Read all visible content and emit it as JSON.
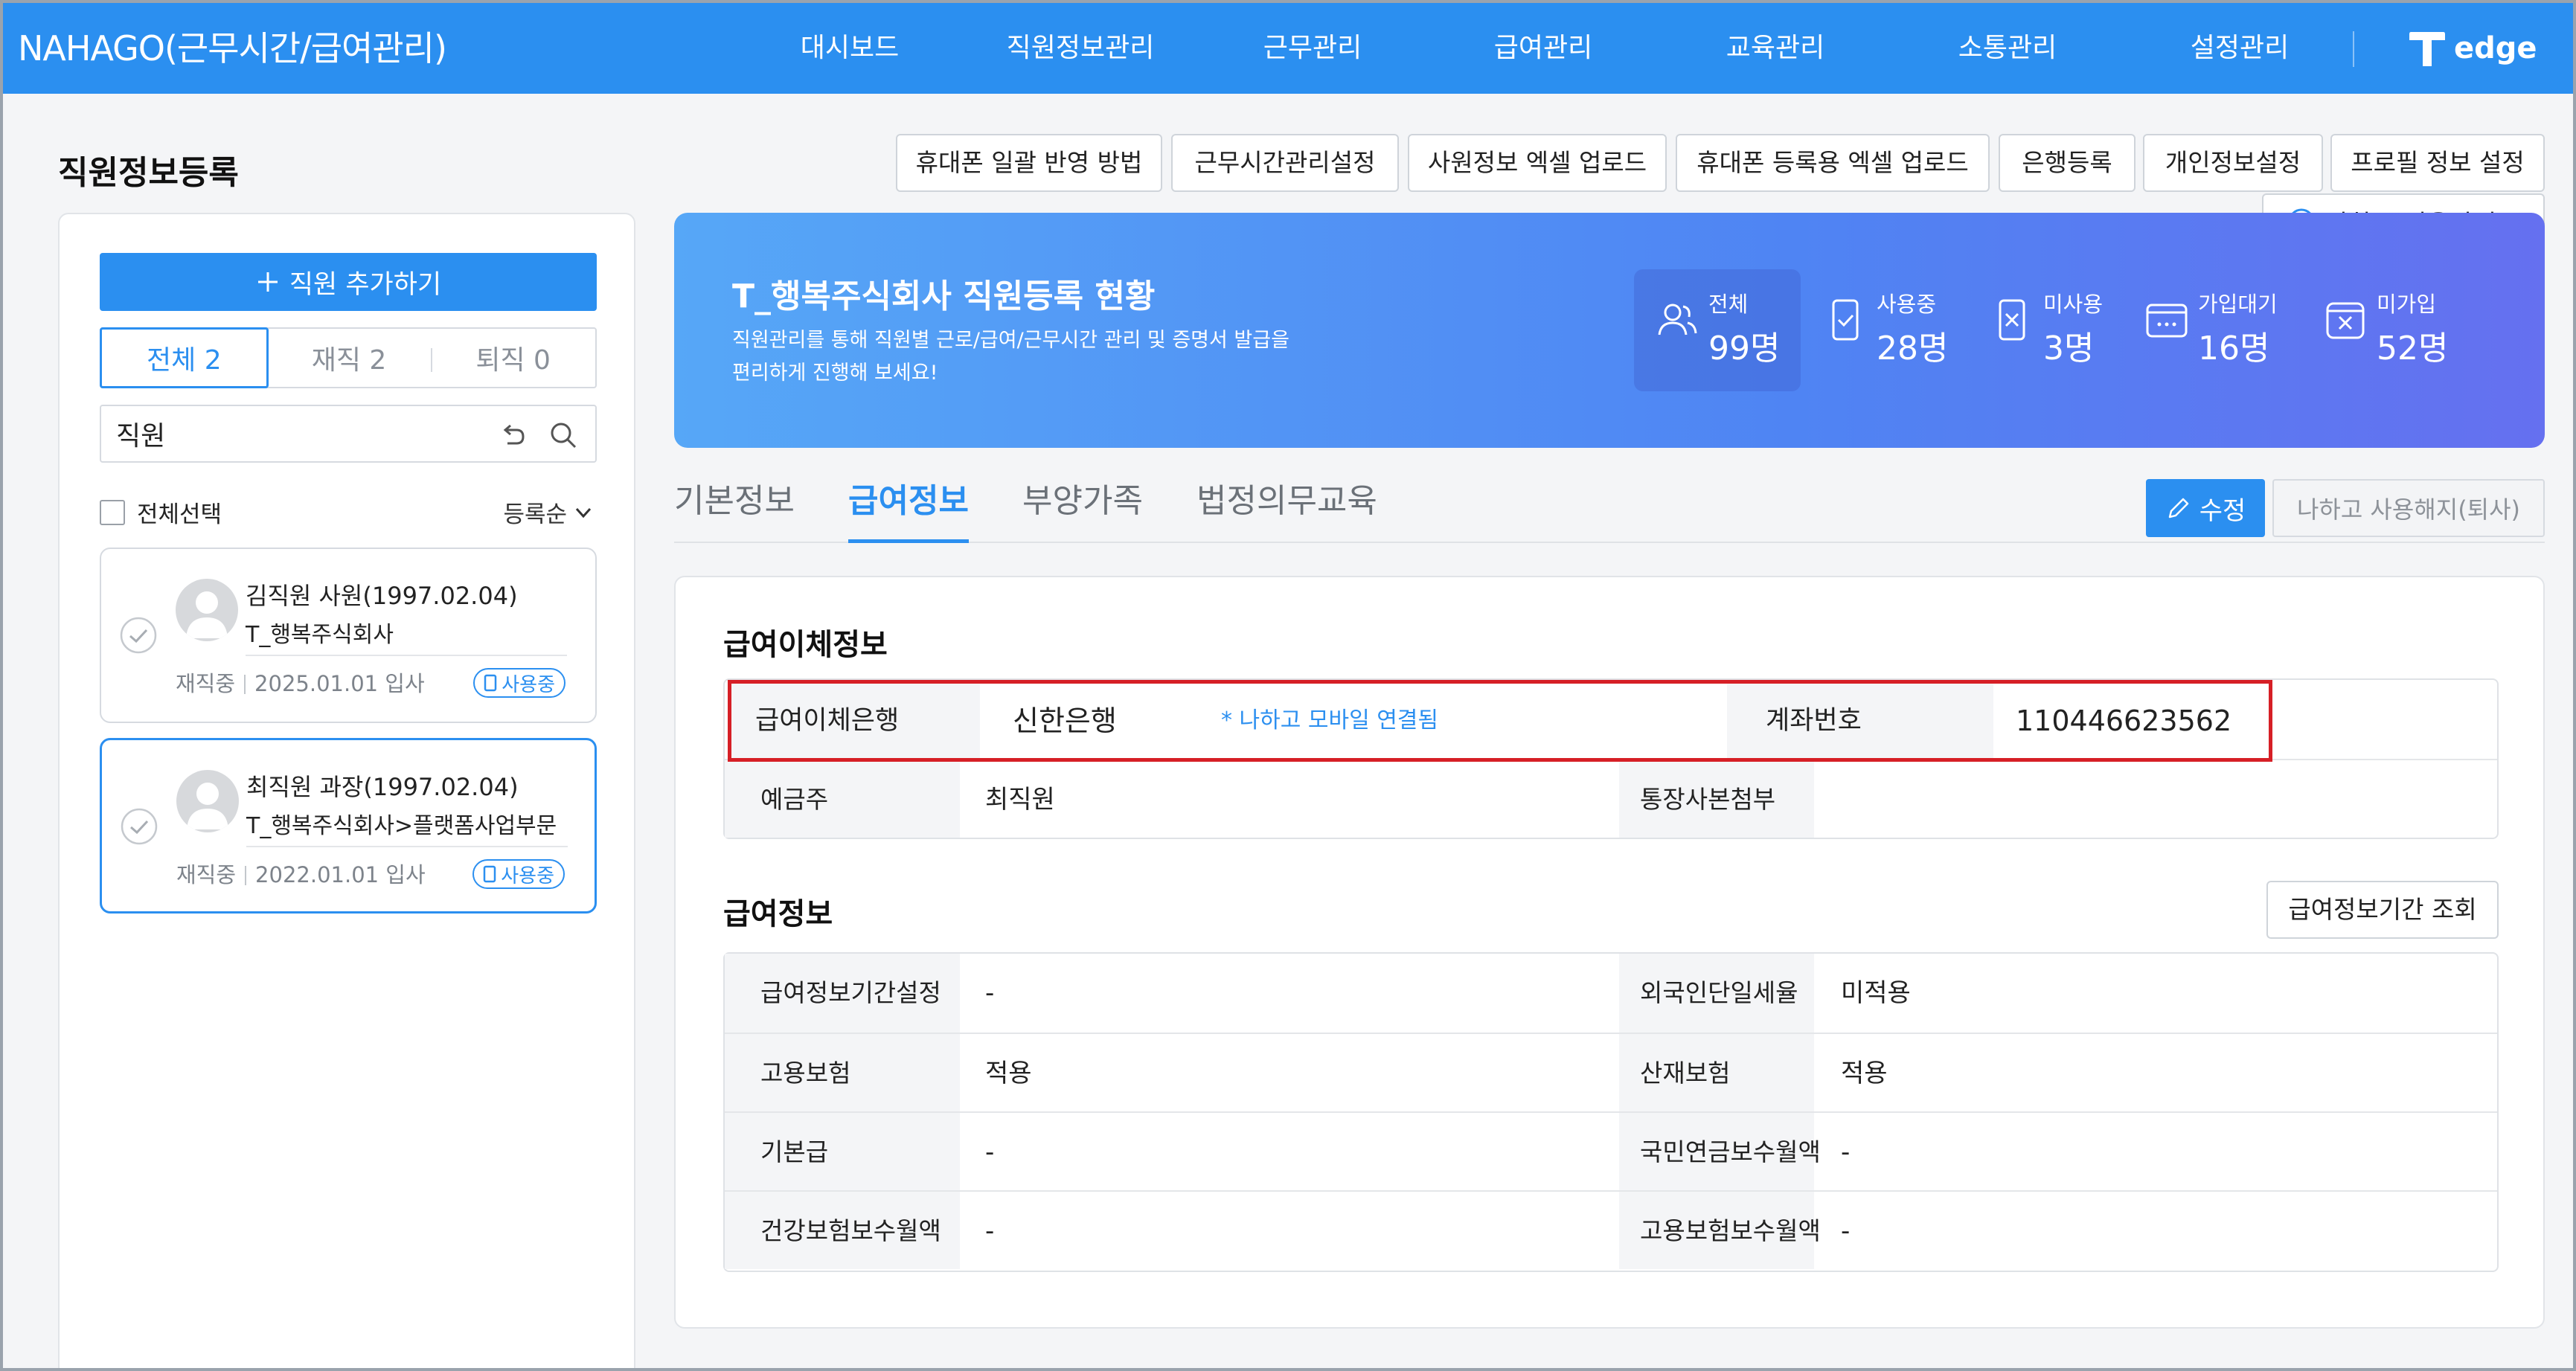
{
  "header": {
    "brand": "NAHAGO(근무시간/급여관리)",
    "nav": [
      "대시보드",
      "직원정보관리",
      "근무관리",
      "급여관리",
      "교육관리",
      "소통관리",
      "설정관리"
    ],
    "logo_text": "edge"
  },
  "page_title": "직원정보등록",
  "toolbar": [
    "휴대폰 일괄 반영 방법",
    "근무시간관리설정",
    "사원정보 엑셀 업로드",
    "휴대폰 등록용 엑셀 업로드",
    "은행등록",
    "개인정보설정",
    "프로필 정보 설정"
  ],
  "guide_label": "나하고 이용가이드",
  "sidebar": {
    "add_button": "직원 추가하기",
    "filters": [
      "전체 2",
      "재직 2",
      "퇴직 0"
    ],
    "active_filter": 0,
    "search_value": "직원",
    "select_all_label": "전체선택",
    "sort_label": "등록순",
    "employees": [
      {
        "name": "김직원 사원(1997.02.04)",
        "org": "T_행복주식회사",
        "status": "재직중",
        "join": "2025.01.01 입사",
        "badge": "사용중",
        "selected": false
      },
      {
        "name": "최직원 과장(1997.02.04)",
        "org": "T_행복주식회사>플랫폼사업부문",
        "status": "재직중",
        "join": "2022.01.01 입사",
        "badge": "사용중",
        "selected": true
      }
    ]
  },
  "banner": {
    "title": "T_행복주식회사 직원등록 현황",
    "desc_line1": "직원관리를 통해 직원별 근로/급여/근무시간 관리 및 증명서 발급을",
    "desc_line2": "편리하게 진행해 보세요!",
    "stats": [
      {
        "label": "전체",
        "value": "99명",
        "icon": "people-icon"
      },
      {
        "label": "사용중",
        "value": "28명",
        "icon": "phone-check-icon"
      },
      {
        "label": "미사용",
        "value": "3명",
        "icon": "phone-x-icon"
      },
      {
        "label": "가입대기",
        "value": "16명",
        "icon": "pending-icon"
      },
      {
        "label": "미가입",
        "value": "52명",
        "icon": "unregistered-icon"
      }
    ]
  },
  "tabs": [
    "기본정보",
    "급여정보",
    "부양가족",
    "법정의무교육"
  ],
  "active_tab": 1,
  "edit_button": "수정",
  "resign_button": "나하고 사용해지(퇴사)",
  "payroll_transfer": {
    "title": "급여이체정보",
    "bank_label": "급여이체은행",
    "bank_value": "신한은행",
    "mobile_note": "* 나하고 모바일 연결됨",
    "account_label": "계좌번호",
    "account_value": "110446623562",
    "holder_label": "예금주",
    "holder_value": "최직원",
    "bankbook_label": "통장사본첨부",
    "bankbook_value": ""
  },
  "salary_info": {
    "title": "급여정보",
    "period_button": "급여정보기간 조회",
    "rows": [
      {
        "l1": "급여정보기간설정",
        "v1": "-",
        "l2": "외국인단일세율",
        "v2": "미적용"
      },
      {
        "l1": "고용보험",
        "v1": "적용",
        "l2": "산재보험",
        "v2": "적용"
      },
      {
        "l1": "기본급",
        "v1": "-",
        "l2": "국민연금보수월액",
        "v2": "-"
      },
      {
        "l1": "건강보험보수월액",
        "v1": "-",
        "l2": "고용보험보수월액",
        "v2": "-"
      }
    ]
  },
  "colors": {
    "primary": "#2b8ff0",
    "highlight": "#d61f26"
  }
}
